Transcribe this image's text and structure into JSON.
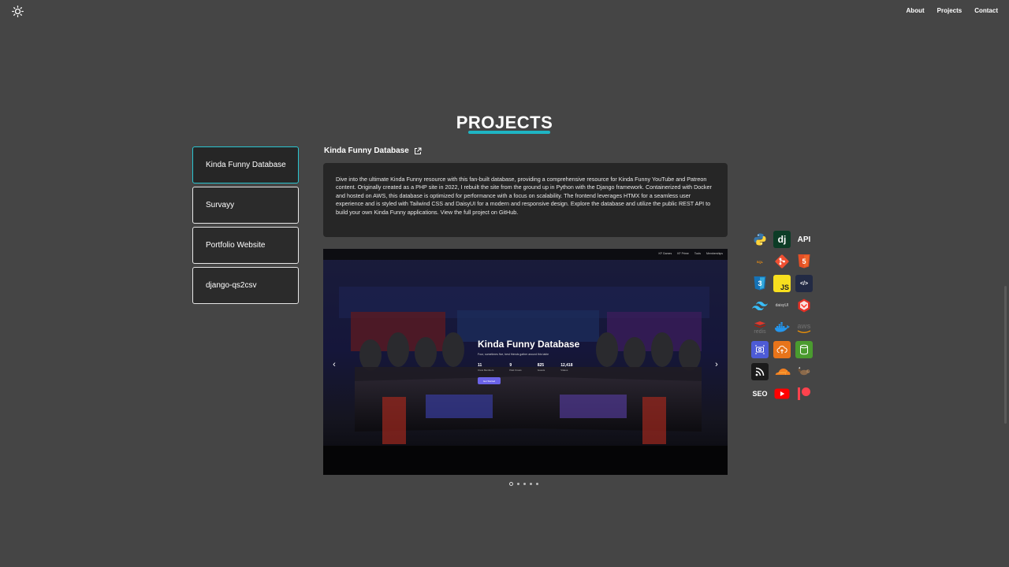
{
  "nav": {
    "about": "About",
    "projects": "Projects",
    "contact": "Contact"
  },
  "section": {
    "title": "PROJECTS",
    "accent_color": "#1fb5c4"
  },
  "tabs": [
    {
      "label": "Kinda Funny Database",
      "active": true
    },
    {
      "label": "Survayy"
    },
    {
      "label": "Portfolio Website"
    },
    {
      "label": "django-qs2csv"
    }
  ],
  "project": {
    "title": "Kinda Funny Database",
    "description": "Dive into the ultimate Kinda Funny resource with this fan-built database, providing a comprehensive resource for Kinda Funny YouTube and Patreon content. Originally created as a PHP site in 2022, I rebuilt the site from the ground up in Python with the Django framework. Containerized with Docker and hosted on AWS, this database is optimized for performance with a focus on scalability. The frontend leverages HTMX for a seamless user experience and is styled with Tailwind CSS and DaisyUI for a modern and responsive design. Explore the database and utilize the public REST API to build your own Kinda Funny applications. View the full project on GitHub.",
    "screenshot": {
      "nav": [
        "KF Games",
        "KF Prime",
        "Tools",
        "Memberships"
      ],
      "title": "Kinda Funny Database",
      "subtitle": "Four, sometimes five, best friends gather around this table",
      "stats": [
        {
          "value": "11",
          "label": "Crew Members"
        },
        {
          "value": "9",
          "label": "Past Crews"
        },
        {
          "value": "825",
          "label": "Guests"
        },
        {
          "value": "12,418",
          "label": "Videos"
        }
      ],
      "button": "Get Started"
    },
    "carousel": {
      "slides": 5,
      "current": 1
    }
  },
  "tech_icons": [
    {
      "name": "python-icon",
      "text": "",
      "color": "#3776ab"
    },
    {
      "name": "django-icon",
      "text": "dj",
      "color": "#0c3c26"
    },
    {
      "name": "api-icon",
      "text": "API",
      "color": "#ffffff"
    },
    {
      "name": "sql-icon",
      "text": "SQL",
      "color": "#f29111"
    },
    {
      "name": "git-icon",
      "text": "",
      "color": "#f05032"
    },
    {
      "name": "html5-icon",
      "text": "5",
      "color": "#e34f26"
    },
    {
      "name": "css3-icon",
      "text": "3",
      "color": "#1572b6"
    },
    {
      "name": "javascript-icon",
      "text": "JS",
      "color": "#f7df1e"
    },
    {
      "name": "htmx-icon",
      "text": "</>",
      "color": "#3d72d7"
    },
    {
      "name": "tailwind-icon",
      "text": "",
      "color": "#38bdf8"
    },
    {
      "name": "daisyui-icon",
      "text": "daisyUI",
      "color": "#ffffff"
    },
    {
      "name": "laravel-icon",
      "text": "",
      "color": "#ff2d20"
    },
    {
      "name": "redis-icon",
      "text": "redis",
      "color": "#dc382d"
    },
    {
      "name": "docker-icon",
      "text": "",
      "color": "#2496ed"
    },
    {
      "name": "aws-icon",
      "text": "aws",
      "color": "#ff9900"
    },
    {
      "name": "aws-service-icon",
      "text": "",
      "color": "#5a67d8"
    },
    {
      "name": "cloud-upload-icon",
      "text": "",
      "color": "#ed7100"
    },
    {
      "name": "storage-icon",
      "text": "",
      "color": "#3f8624"
    },
    {
      "name": "rss-icon",
      "text": "",
      "color": "#1b1b1b"
    },
    {
      "name": "cloudflare-icon",
      "text": "",
      "color": "#f38020"
    },
    {
      "name": "squirrel-icon",
      "text": "",
      "color": "#8b6a4b"
    },
    {
      "name": "seo-icon",
      "text": "SEO",
      "color": "#ffffff"
    },
    {
      "name": "youtube-icon",
      "text": "",
      "color": "#ff0000"
    },
    {
      "name": "patreon-icon",
      "text": "",
      "color": "#ff424d"
    }
  ]
}
